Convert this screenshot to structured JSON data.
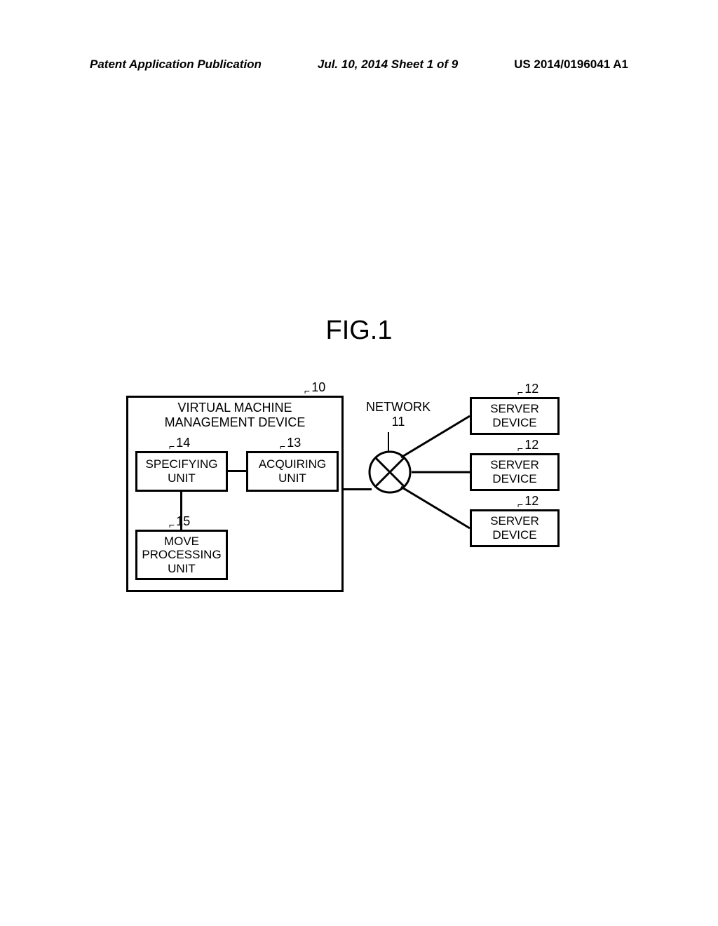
{
  "header": {
    "left": "Patent Application Publication",
    "center": "Jul. 10, 2014  Sheet 1 of 9",
    "right": "US 2014/0196041 A1"
  },
  "figure": {
    "title": "FIG.1",
    "vmm": {
      "title_line1": "VIRTUAL MACHINE",
      "title_line2": "MANAGEMENT DEVICE",
      "ref": "10",
      "spec": {
        "label_line1": "SPECIFYING",
        "label_line2": "UNIT",
        "ref": "14"
      },
      "acq": {
        "label_line1": "ACQUIRING",
        "label_line2": "UNIT",
        "ref": "13"
      },
      "move": {
        "label_line1": "MOVE",
        "label_line2": "PROCESSING",
        "label_line3": "UNIT",
        "ref": "15"
      }
    },
    "network": {
      "label_line1": "NETWORK",
      "label_line2": "11"
    },
    "server": {
      "label_line1": "SERVER",
      "label_line2": "DEVICE",
      "ref": "12"
    }
  }
}
